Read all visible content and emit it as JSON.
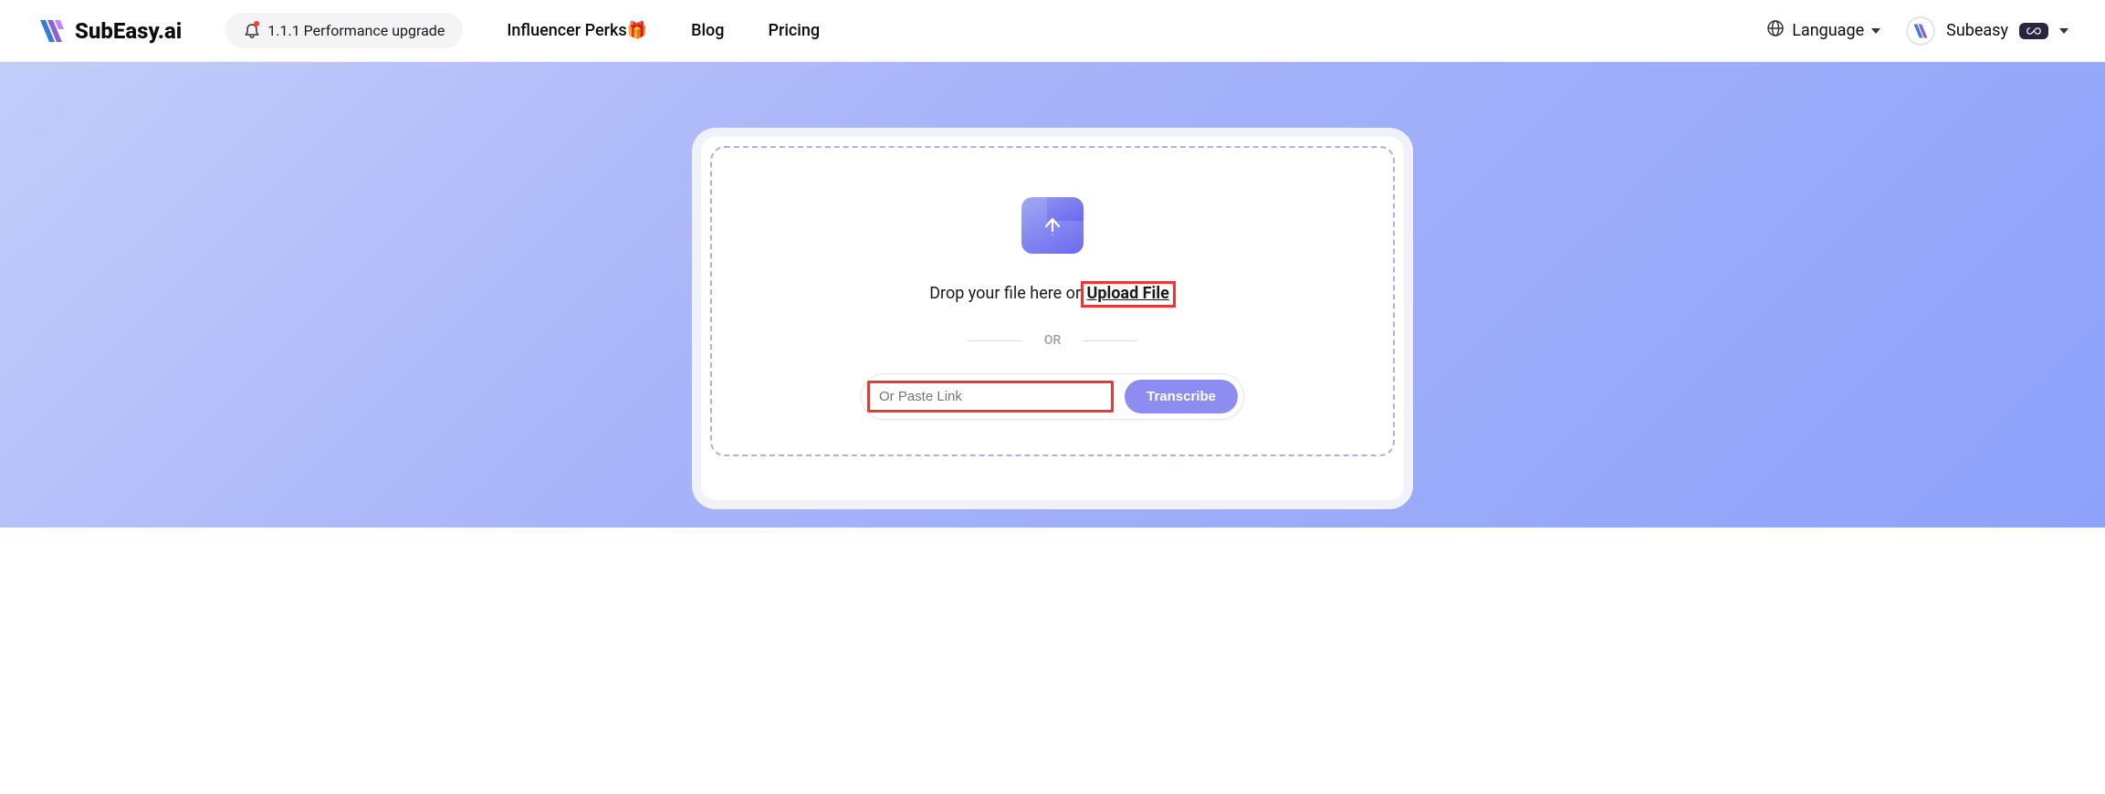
{
  "header": {
    "logo_text": "SubEasy.ai",
    "notice": "1.1.1 Performance upgrade",
    "nav": {
      "influencer": "Influencer Perks",
      "blog": "Blog",
      "pricing": "Pricing"
    },
    "language_label": "Language",
    "user_name": "Subeasy"
  },
  "upload": {
    "drop_prefix": "Drop your file here or ",
    "upload_link": "Upload File",
    "or": "OR",
    "paste_placeholder": "Or Paste Link",
    "transcribe": "Transcribe"
  },
  "icons": {
    "gift": "🎁",
    "infinity": "∞"
  }
}
